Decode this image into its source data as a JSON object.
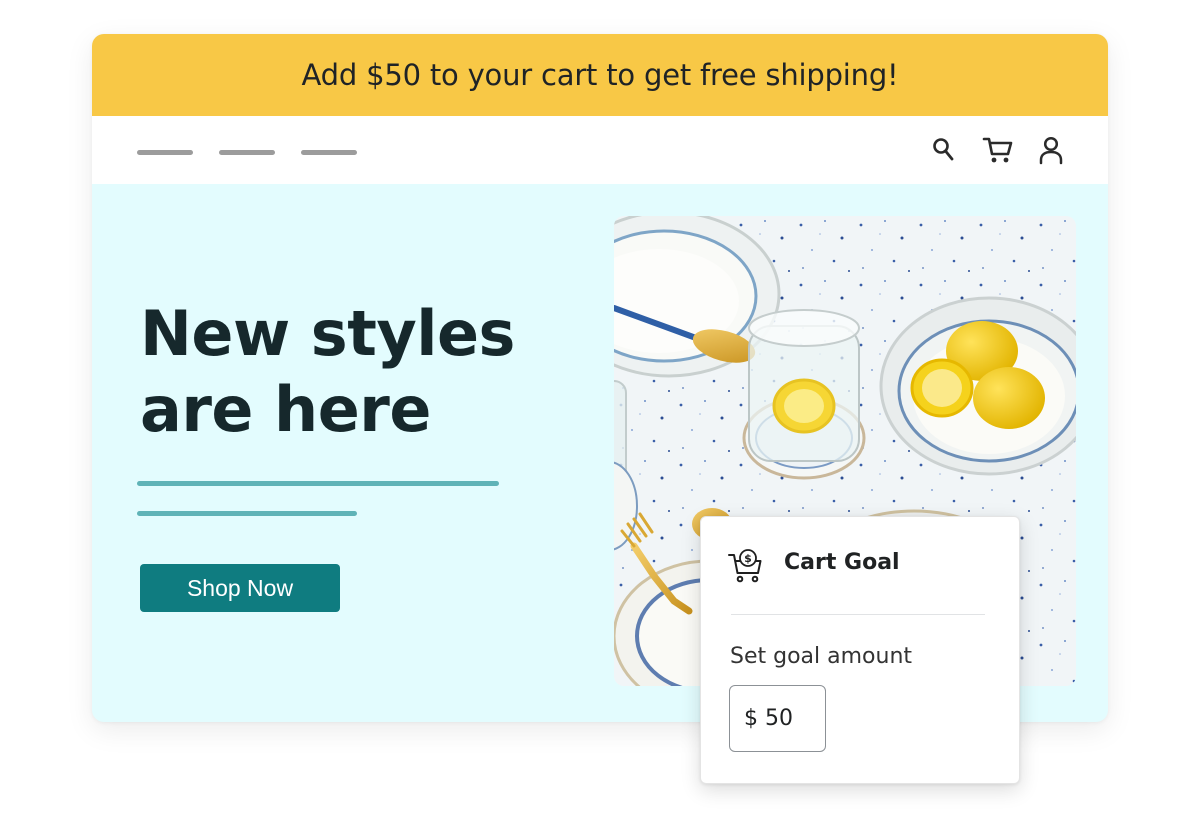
{
  "announcement": {
    "text": "Add $50 to your cart to get free shipping!"
  },
  "nav": {
    "icons": [
      "search-icon",
      "cart-icon",
      "user-icon"
    ]
  },
  "hero": {
    "title": "New styles are here",
    "button_label": "Shop Now",
    "image": "tableware-with-lemons-photo"
  },
  "cart_goal": {
    "title": "Cart Goal",
    "icon": "cart-dollar-icon",
    "field_label": "Set goal amount",
    "currency": "$",
    "value": "50"
  },
  "colors": {
    "announcement_bg": "#f8c846",
    "hero_bg": "#e3fcfe",
    "button_bg": "#0f7c80",
    "accent_line": "#5fb3b7",
    "heading": "#16282c"
  }
}
